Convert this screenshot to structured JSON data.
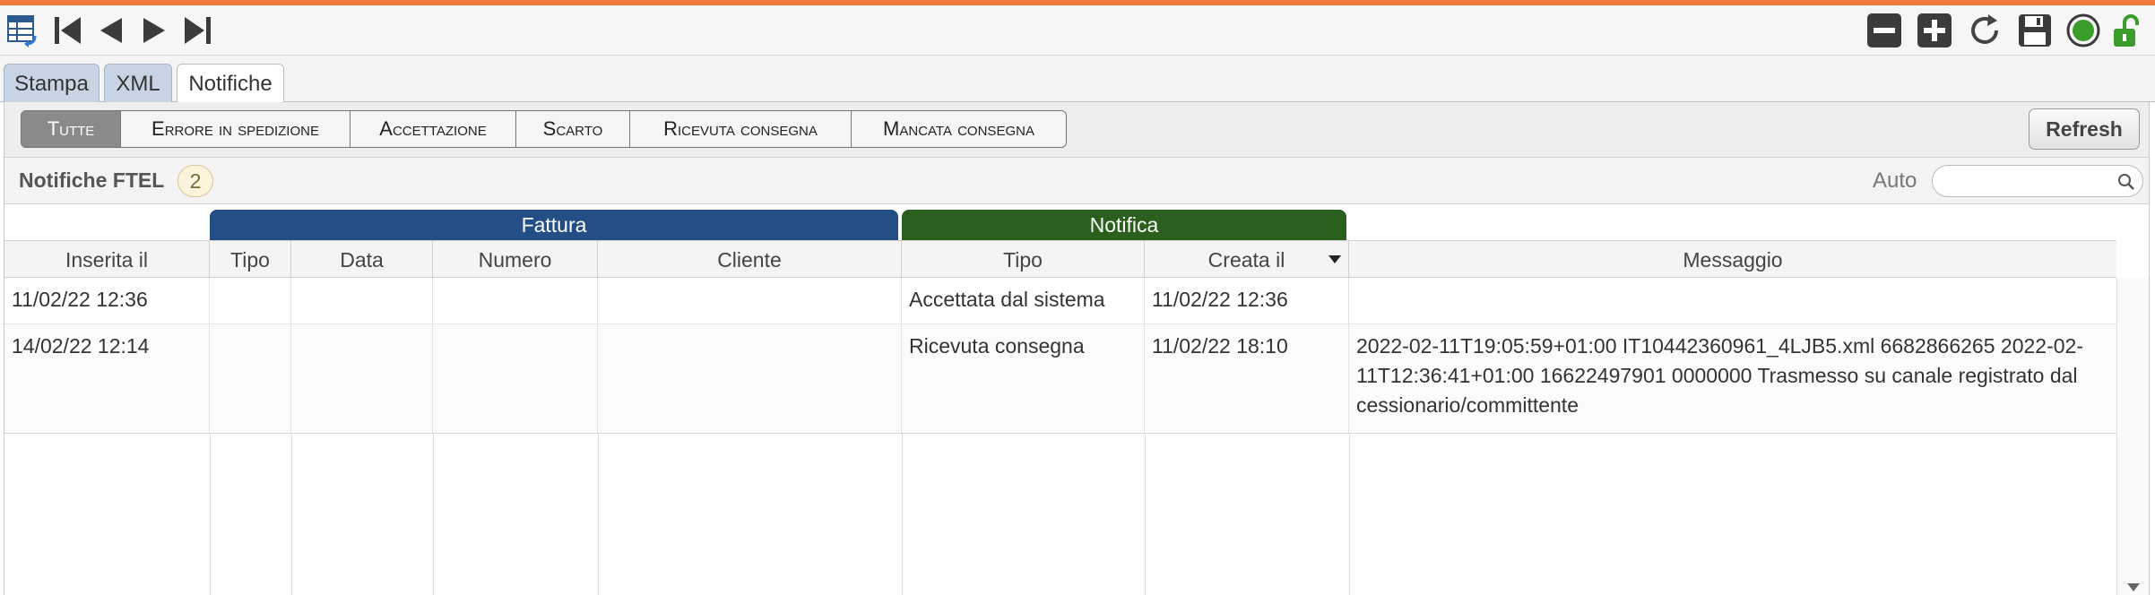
{
  "colors": {
    "accent": "#f07a3c",
    "fattura": "#234f86",
    "notifica": "#2b5f1e"
  },
  "toolbar": {
    "left_icons": [
      "table-view-icon",
      "first-record-icon",
      "previous-record-icon",
      "next-record-icon",
      "last-record-icon"
    ],
    "right_icons": [
      "remove-icon",
      "add-icon",
      "reload-icon",
      "save-icon",
      "status-icon",
      "unlock-icon"
    ]
  },
  "tabs": [
    {
      "label": "Stampa",
      "active": false
    },
    {
      "label": "XML",
      "active": false
    },
    {
      "label": "Notifiche",
      "active": true
    }
  ],
  "filters": [
    {
      "label": "Tutte",
      "active": true
    },
    {
      "label": "Errore in spedizione",
      "active": false
    },
    {
      "label": "Accettazione",
      "active": false
    },
    {
      "label": "Scarto",
      "active": false
    },
    {
      "label": "Ricevuta consegna",
      "active": false
    },
    {
      "label": "Mancata consegna",
      "active": false
    }
  ],
  "refresh_label": "Refresh",
  "grid": {
    "title": "Notifiche FTEL",
    "count": "2",
    "auto_label": "Auto",
    "search_value": "",
    "groups": {
      "fattura": "Fattura",
      "notifica": "Notifica"
    },
    "columns": [
      "Inserita il",
      "Tipo",
      "Data",
      "Numero",
      "Cliente",
      "Tipo",
      "Creata il",
      "Messaggio"
    ],
    "rows": [
      {
        "inserita": "11/02/22 12:36",
        "f_tipo": "",
        "f_data": "",
        "f_numero": "",
        "cliente": "",
        "n_tipo": "Accettata dal sistema",
        "creata": "11/02/22 12:36",
        "messaggio": ""
      },
      {
        "inserita": "14/02/22 12:14",
        "f_tipo": "",
        "f_data": "",
        "f_numero": "",
        "cliente": "",
        "n_tipo": "Ricevuta consegna",
        "creata": "11/02/22 18:10",
        "messaggio": "2022-02-11T19:05:59+01:00 IT10442360961_4LJB5.xml 6682866265 2022-02-11T12:36:41+01:00 16622497901 0000000 Trasmesso su canale registrato dal cessionario/committente"
      }
    ]
  }
}
